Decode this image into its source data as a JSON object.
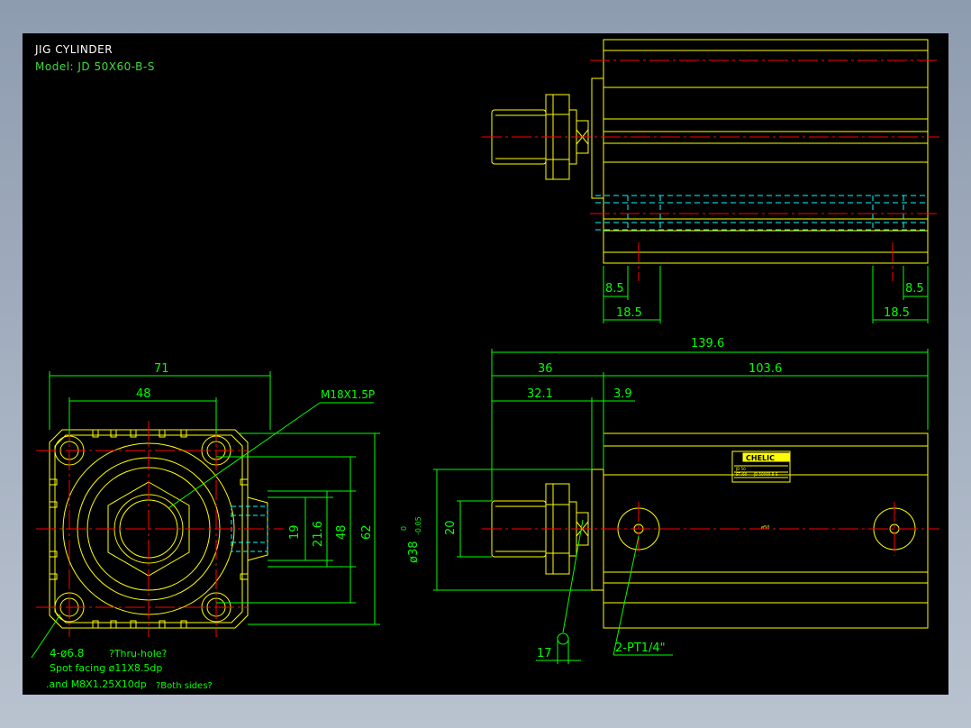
{
  "drawing": {
    "title": "JIG CYLINDER",
    "model": "Model: JD 50X60-B-S",
    "brand_plate": "CHELIC",
    "plate_fine_print": [
      "JD 50",
      "ST.:60",
      "JD 50X60-B-S"
    ],
    "bore_mark": "ø50"
  },
  "dims": {
    "d_71": "71",
    "d_48_top": "48",
    "d_19": "19",
    "d_21_6": "21.6",
    "d_48_right": "48",
    "d_62": "62",
    "d_139_6": "139.6",
    "d_36": "36",
    "d_103_6": "103.6",
    "d_32_1": "32.1",
    "d_3_9": "3.9",
    "d_20": "20",
    "d_38": "ø38",
    "d_38_tol_top": "0",
    "d_38_tol_bot": "-0.05",
    "d_17": "17",
    "d_8_5_l": "8.5",
    "d_8_5_r": "8.5",
    "d_18_5_l": "18.5",
    "d_18_5_r": "18.5"
  },
  "callouts": {
    "thread": "M18X1.5P",
    "port": "2-PT1/4\"",
    "holes": "4-ø6.8",
    "thru": "?Thru-hole?",
    "spot": "Spot facing  ø11X8.5dp",
    "and": ".and M8X1.25X10dp",
    "both": "?Both sides?"
  },
  "colors": {
    "background": "#000000",
    "outline": "#ffff00",
    "dimension": "#00ff00",
    "centerline": "#ff0000",
    "hidden": "#00ffff",
    "text_white": "#ffffff"
  }
}
